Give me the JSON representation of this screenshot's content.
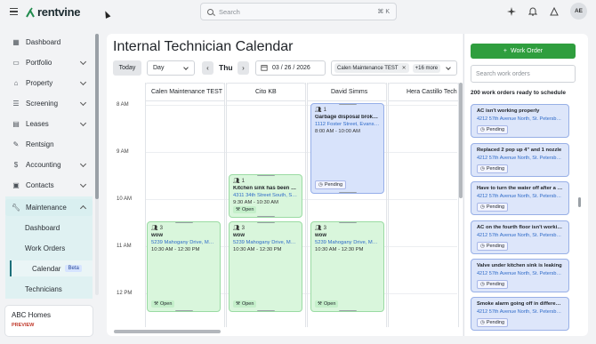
{
  "topbar": {
    "logo_text": "rentvine",
    "search_placeholder": "Search",
    "search_shortcut": "⌘ K",
    "avatar_initials": "AE"
  },
  "sidebar": {
    "items": [
      {
        "label": "Dashboard",
        "icon": "grid-icon"
      },
      {
        "label": "Portfolio",
        "icon": "folder-icon"
      },
      {
        "label": "Property",
        "icon": "home-icon"
      },
      {
        "label": "Screening",
        "icon": "list-icon"
      },
      {
        "label": "Leases",
        "icon": "document-icon"
      },
      {
        "label": "Rentsign",
        "icon": "signature-icon"
      },
      {
        "label": "Accounting",
        "icon": "dollar-icon"
      },
      {
        "label": "Contacts",
        "icon": "contacts-icon"
      },
      {
        "label": "Maintenance",
        "icon": "wrench-icon"
      }
    ],
    "maintenance_sub": {
      "dashboard": "Dashboard",
      "work_orders": "Work Orders",
      "calendar": "Calendar",
      "beta": "Beta",
      "technicians": "Technicians"
    },
    "org": {
      "name": "ABC Homes",
      "tag": "PREVIEW"
    }
  },
  "calendar": {
    "title": "Internal Technician Calendar",
    "today_label": "Today",
    "view_select": "Day",
    "day_label": "Thu",
    "date": "03 / 26 / 2026",
    "filter_chip": "Calen Maintenance TEST",
    "filter_more": "+16 more",
    "times": [
      "8 AM",
      "9 AM",
      "10 AM",
      "11 AM",
      "12 PM"
    ],
    "columns": [
      "Calen Maintenance TEST",
      "Cito KB",
      "David Simms",
      "Hera Castillo Tech"
    ],
    "events": [
      {
        "count": "1",
        "title": "Garbage disposal brokenwoe",
        "address": "1112 Foster Street, Evanston,...",
        "time": "8:00 AM - 10:00 AM",
        "status": "Pending"
      },
      {
        "count": "1",
        "title": "Kitchen sink has been drain...",
        "address": "4311 34th Street South, St. P...",
        "time": "9:30 AM - 10:30 AM",
        "status": "Open"
      },
      {
        "count": "3",
        "title": "wow",
        "address": "5239 Mahogany Drive, Mou...",
        "time": "10:30 AM - 12:30 PM",
        "status": "Open"
      },
      {
        "count": "3",
        "title": "wow",
        "address": "5239 Mahogany Drive, Mou...",
        "time": "10:30 AM - 12:30 PM",
        "status": "Open"
      },
      {
        "count": "3",
        "title": "wow",
        "address": "5239 Mahogany Drive, Mou...",
        "time": "10:30 AM - 12:30 PM",
        "status": "Open"
      }
    ]
  },
  "work_orders": {
    "button_label": "Work Order",
    "search_placeholder": "Search work orders",
    "count_label": "200 work orders ready to schedule",
    "items": [
      {
        "title": "AC isn't working properly",
        "address": "4212 57th Avenue North, St. Petersbu...",
        "status": "Pending"
      },
      {
        "title": "Replaced 2 pop up 4\" and 1 nozzle",
        "address": "4212 57th Avenue North, St. Petersbu...",
        "status": "Pending"
      },
      {
        "title": "Have to turn the water off after a flus...",
        "address": "4212 57th Avenue North, St. Petersbu...",
        "status": "Pending"
      },
      {
        "title": "AC on the fourth floor isn't working",
        "address": "4212 57th Avenue North, St. Petersbu...",
        "status": "Pending"
      },
      {
        "title": "Valve under kitchen sink is leaking",
        "address": "4212 57th Avenue North, St. Petersbu...",
        "status": "Pending"
      },
      {
        "title": "Smoke alarm going off in different ar...",
        "address": "4212 57th Avenue North, St. Petersbu...",
        "status": "Pending"
      }
    ]
  }
}
